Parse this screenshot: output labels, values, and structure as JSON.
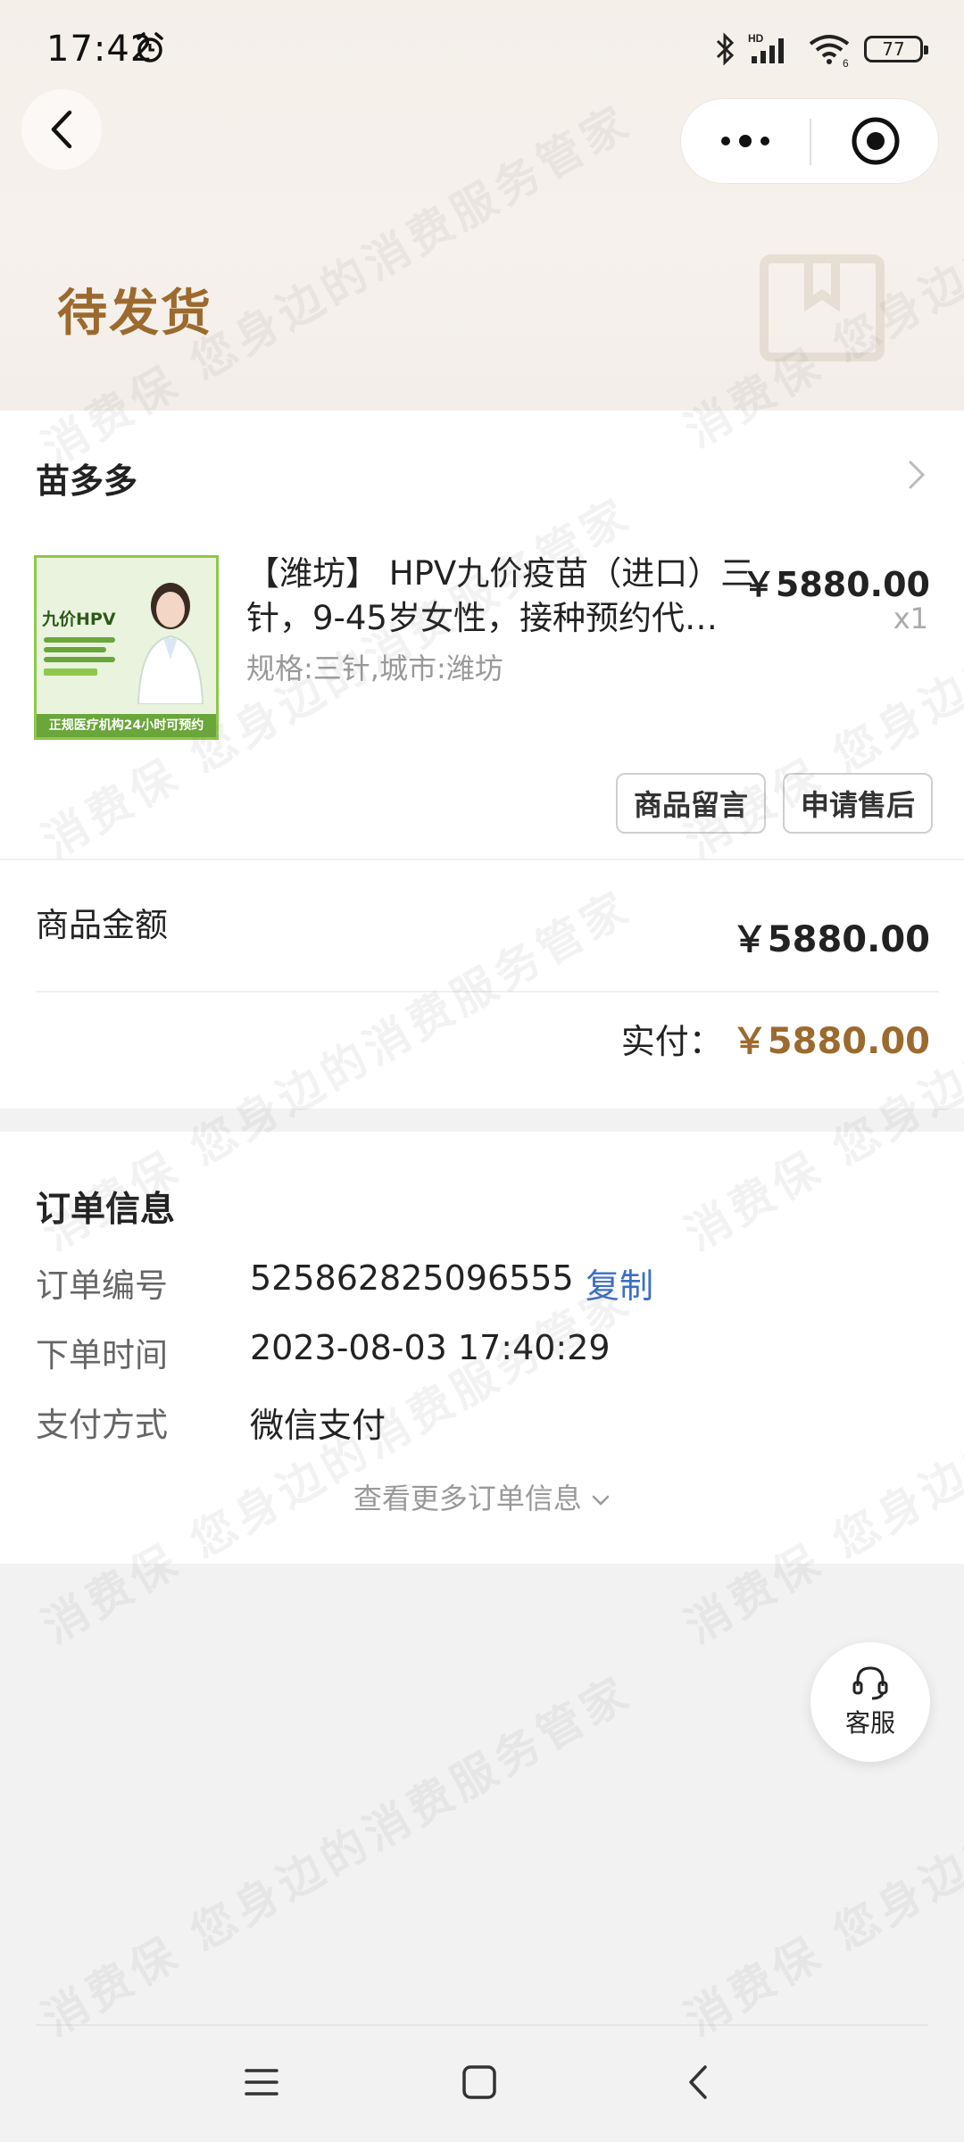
{
  "status_bar": {
    "time": "17:42",
    "battery": "77"
  },
  "header": {
    "order_status": "待发货"
  },
  "store": {
    "name": "苗多多"
  },
  "product": {
    "title": "【潍坊】 HPV九价疫苗（进口）三针，9-45岁女性，接种预约代…",
    "spec": "规格:三针,城市:潍坊",
    "price": "￥5880.00",
    "qty": "x1",
    "image_badge": "九价HPV",
    "image_footer": "正规医疗机构24小时可预约"
  },
  "actions": {
    "message": "商品留言",
    "after_sale": "申请售后"
  },
  "amounts": {
    "goods_label": "商品金额",
    "goods_value": "￥5880.00",
    "paid_label": "实付：",
    "paid_value": "￥5880.00"
  },
  "order_info": {
    "title": "订单信息",
    "number_label": "订单编号",
    "number_value": "525862825096555",
    "copy": "复制",
    "time_label": "下单时间",
    "time_value": "2023-08-03 17:40:29",
    "pay_label": "支付方式",
    "pay_value": "微信支付",
    "more": "查看更多订单信息"
  },
  "service": {
    "label": "客服"
  },
  "watermark": {
    "text": "消费保 您身边的消费服务管家"
  },
  "colors": {
    "accent": "#9c6a2e",
    "link": "#3a6fc4"
  }
}
